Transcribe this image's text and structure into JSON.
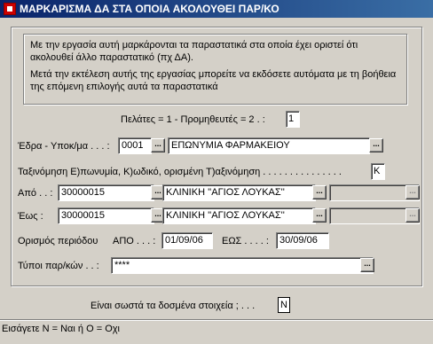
{
  "window": {
    "title": "ΜΑΡΚΑΡΙΣΜΑ ΔΑ ΣΤΑ ΟΠΟΙΑ ΑΚΟΛΟΥΘΕΙ ΠΑΡ/ΚΟ"
  },
  "info": {
    "line1": "Με την εργασία αυτή μαρκάρονται τα παραστατικά στα οποία έχει οριστεί ότι ακολουθεί άλλο παραστατικό (πχ ΔΑ).",
    "line2": "Μετά την εκτέλεση αυτής της εργασίας μπορείτε να εκδόσετε αυτόματα με τη βοήθεια της επόμενη επιλογής αυτά τα παραστατικά"
  },
  "form": {
    "customers_suppliers_label": "Πελάτες = 1 - Προμηθευτές = 2 .  :",
    "customers_suppliers_value": "1",
    "seat_label": "Έδρα - Υποκ/μα . . . :",
    "seat_code": "0001",
    "seat_name": "ΕΠΩΝΥΜΙΑ ΦΑΡΜΑΚΕΙΟΥ",
    "sort_label": "Ταξινόμηση Ε)πωνυμία, Κ)ωδικό, ορισμένη Τ)αξινόμηση . . . . . . . . . . . . . . .",
    "sort_value": "K",
    "from_label": "Από . . :",
    "from_code": "30000015",
    "from_name": "ΚΛΙΝΙΚΗ ''ΑΓΙΟΣ ΛΟΥΚΑΣ''",
    "to_label": "Έως  :",
    "to_code": "30000015",
    "to_name": "ΚΛΙΝΙΚΗ ''ΑΓΙΟΣ ΛΟΥΚΑΣ''",
    "period_label": "Ορισμός περιόδου",
    "period_from_label": "ΑΠΟ . . . :",
    "period_from": "01/09/06",
    "period_to_label": "ΕΩΣ . . . . :",
    "period_to": "30/09/06",
    "doc_types_label": "Τύποι παρ/κών . .  :",
    "doc_types_value": "****",
    "browse": "..."
  },
  "confirm": {
    "label": "Είναι σωστά τα δοσμένα στοιχεία ; . . .",
    "value": "N"
  },
  "status": {
    "text": "Εισάγετε N = Ναι  ή  O = Oχι"
  }
}
